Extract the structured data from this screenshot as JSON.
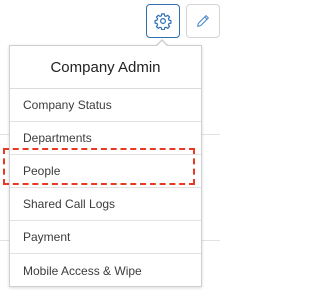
{
  "toolbar": {
    "settings_icon": "gear-icon",
    "edit_icon": "pencil-icon",
    "accent_color": "#2f6fb3"
  },
  "menu": {
    "title": "Company Admin",
    "items": [
      {
        "label": "Company Status"
      },
      {
        "label": "Departments"
      },
      {
        "label": "People"
      },
      {
        "label": "Shared Call Logs"
      },
      {
        "label": "Payment"
      },
      {
        "label": "Mobile Access & Wipe"
      }
    ],
    "highlight_color": "#e63a24"
  }
}
